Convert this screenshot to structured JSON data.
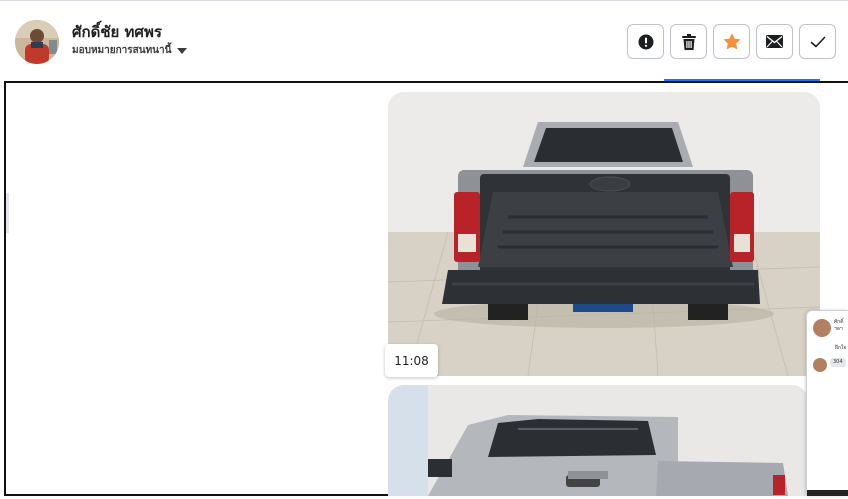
{
  "header": {
    "user_name": "ศักดิ์ชัย ทศพร",
    "assign_label": "มอบหมายการสนทนานี้"
  },
  "actions": [
    {
      "icon": "alert-icon"
    },
    {
      "icon": "trash-icon"
    },
    {
      "icon": "star-icon",
      "color": "#f7923a"
    },
    {
      "icon": "envelope-icon"
    },
    {
      "icon": "check-icon"
    }
  ],
  "messages": [
    {
      "type": "image",
      "content": "rear of silver Ford pickup truck with open cargo bed",
      "timestamp": "11:08"
    },
    {
      "type": "image",
      "content": "silver Ford pickup truck cab, rear three-quarter view"
    }
  ],
  "mini_panel": {
    "rows": [
      {
        "name": "ศักดิ์",
        "preview": "ฯลฯ"
      },
      {
        "name": "ฝึกใจ",
        "preview": "304"
      }
    ]
  },
  "colors": {
    "accent_blue": "#1877f2",
    "star_orange": "#f7923a"
  }
}
